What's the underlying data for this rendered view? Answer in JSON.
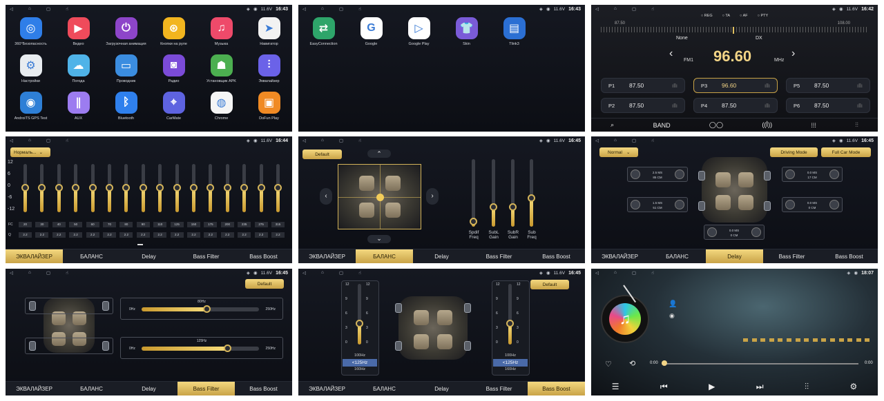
{
  "status": {
    "voltage": "11.6V",
    "times": [
      "16:43",
      "16:43",
      "16:42",
      "16:44",
      "16:45",
      "16:45",
      "16:45",
      "16:45",
      "18:07"
    ]
  },
  "apps_page1": [
    {
      "label": "360°Безопасность",
      "icon": "shield-camera-icon",
      "color": "#2f7ee8"
    },
    {
      "label": "Видео",
      "icon": "play-icon",
      "color": "#ef4b5b"
    },
    {
      "label": "Загрузочная анимация",
      "icon": "power-icon",
      "color": "#8d45c9"
    },
    {
      "label": "Кнопки на руле",
      "icon": "steering-wheel-icon",
      "color": "#f2b51f"
    },
    {
      "label": "Музыка",
      "icon": "music-note-icon",
      "color": "#ee4a6a"
    },
    {
      "label": "Навигатор",
      "icon": "navigation-icon",
      "color": "#f2f2f2"
    },
    {
      "label": "Настройки",
      "icon": "gear-icon",
      "color": "#e8ecf0"
    },
    {
      "label": "Погода",
      "icon": "cloud-icon",
      "color": "#4fb3e8"
    },
    {
      "label": "Проводник",
      "icon": "folder-icon",
      "color": "#3b8de0"
    },
    {
      "label": "Радио",
      "icon": "radio-icon",
      "color": "#7b4bd8"
    },
    {
      "label": "Установщик APK",
      "icon": "android-icon",
      "color": "#4caf50"
    },
    {
      "label": "Эквалайзер",
      "icon": "equalizer-icon",
      "color": "#6b62e8"
    },
    {
      "label": "AndroiTS GPS Test",
      "icon": "gps-icon",
      "color": "#2e7fd6"
    },
    {
      "label": "AUX",
      "icon": "aux-icon",
      "color": "#9c7cf0"
    },
    {
      "label": "Bluetooth",
      "icon": "bluetooth-icon",
      "color": "#2f80ed"
    },
    {
      "label": "CarMate",
      "icon": "carmate-icon",
      "color": "#5e63e0"
    },
    {
      "label": "Chrome",
      "icon": "chrome-icon",
      "color": "#f5f5f5"
    },
    {
      "label": "DoFun Play",
      "icon": "gamepad-icon",
      "color": "#f08a24"
    }
  ],
  "apps_page2": [
    {
      "label": "EasyConnection",
      "icon": "easyconnection-icon",
      "color": "#2ea56a"
    },
    {
      "label": "Google",
      "icon": "google-icon",
      "color": "#ffffff"
    },
    {
      "label": "Google Play",
      "icon": "google-play-icon",
      "color": "#ffffff"
    },
    {
      "label": "Skin",
      "icon": "tshirt-icon",
      "color": "#7a5bd8"
    },
    {
      "label": "Tlink3",
      "icon": "tlink-icon",
      "color": "#2b6fd3"
    }
  ],
  "radio": {
    "options": [
      "REG",
      "TA",
      "AF",
      "PTY"
    ],
    "scale_min": "87.50",
    "scale_max": "108.00",
    "left_label": "None",
    "right_label": "DX",
    "band": "FM1",
    "frequency": "96.60",
    "unit": "MHz",
    "presets": [
      {
        "name": "P1",
        "freq": "87.50"
      },
      {
        "name": "P3",
        "freq": "96.60"
      },
      {
        "name": "P5",
        "freq": "87.50"
      },
      {
        "name": "P2",
        "freq": "87.50"
      },
      {
        "name": "P4",
        "freq": "87.50"
      },
      {
        "name": "P6",
        "freq": "87.50"
      }
    ],
    "band_label": "BAND"
  },
  "eq": {
    "preset": "Нормаль...",
    "y_ticks": [
      "12",
      "6",
      "0",
      "-6",
      "-12"
    ],
    "row_fc": "FC",
    "row_q": "Q",
    "freqs": [
      "20",
      "30",
      "40",
      "50",
      "60",
      "70",
      "80",
      "90",
      "110",
      "125",
      "150",
      "175",
      "200",
      "235",
      "275",
      "315"
    ],
    "q_values": [
      "2.2",
      "2.2",
      "2.2",
      "2.2",
      "2.2",
      "2.2",
      "2.2",
      "2.2",
      "2.2",
      "2.2",
      "2.2",
      "2.2",
      "2.2",
      "2.2",
      "2.2",
      "2.2"
    ],
    "levels": [
      0.52,
      0.52,
      0.52,
      0.52,
      0.52,
      0.52,
      0.52,
      0.52,
      0.52,
      0.52,
      0.52,
      0.52,
      0.52,
      0.52,
      0.52,
      0.52
    ]
  },
  "tabs": [
    "ЭКВАЛАЙЗЕР",
    "БАЛАНС",
    "Delay",
    "Bass Filter",
    "Bass Boost"
  ],
  "balance": {
    "default_label": "Default",
    "slider_labels": [
      "Spdif\nFreq",
      "SubL\nGain",
      "SubR\nGain",
      "Sub\nFreq"
    ],
    "slider_levels": [
      0.08,
      0.3,
      0.3,
      0.43
    ]
  },
  "delay": {
    "mode": "Normal",
    "driving_mode": "Driving Mode",
    "full_car_mode": "Full Car Mode",
    "boxes": [
      {
        "ms": "2.5 MS",
        "cm": "85 CM"
      },
      {
        "ms": "0.0 MS",
        "cm": "17 CM"
      },
      {
        "ms": "1.5 MS",
        "cm": "51 CM"
      },
      {
        "ms": "0.0 MS",
        "cm": "0 CM"
      },
      {
        "ms": "0.0 MS",
        "cm": "0 CM"
      }
    ]
  },
  "bass_filter": {
    "default_label": "Default",
    "slider1_value": "80Hz",
    "slider1_min": "0Hz",
    "slider1_max": "250Hz",
    "slider1_level": 0.55,
    "slider2_value": "125Hz",
    "slider2_min": "0Hz",
    "slider2_max": "250Hz",
    "slider2_level": 0.73
  },
  "bass_boost": {
    "default_label": "Default",
    "ticks": [
      "12",
      "9",
      "6",
      "3",
      "0"
    ],
    "options": [
      "100Hz",
      "<125Hz",
      "160Hz"
    ],
    "level": 0.35
  },
  "player": {
    "time_start": "0:00",
    "time_end": "0:00"
  }
}
